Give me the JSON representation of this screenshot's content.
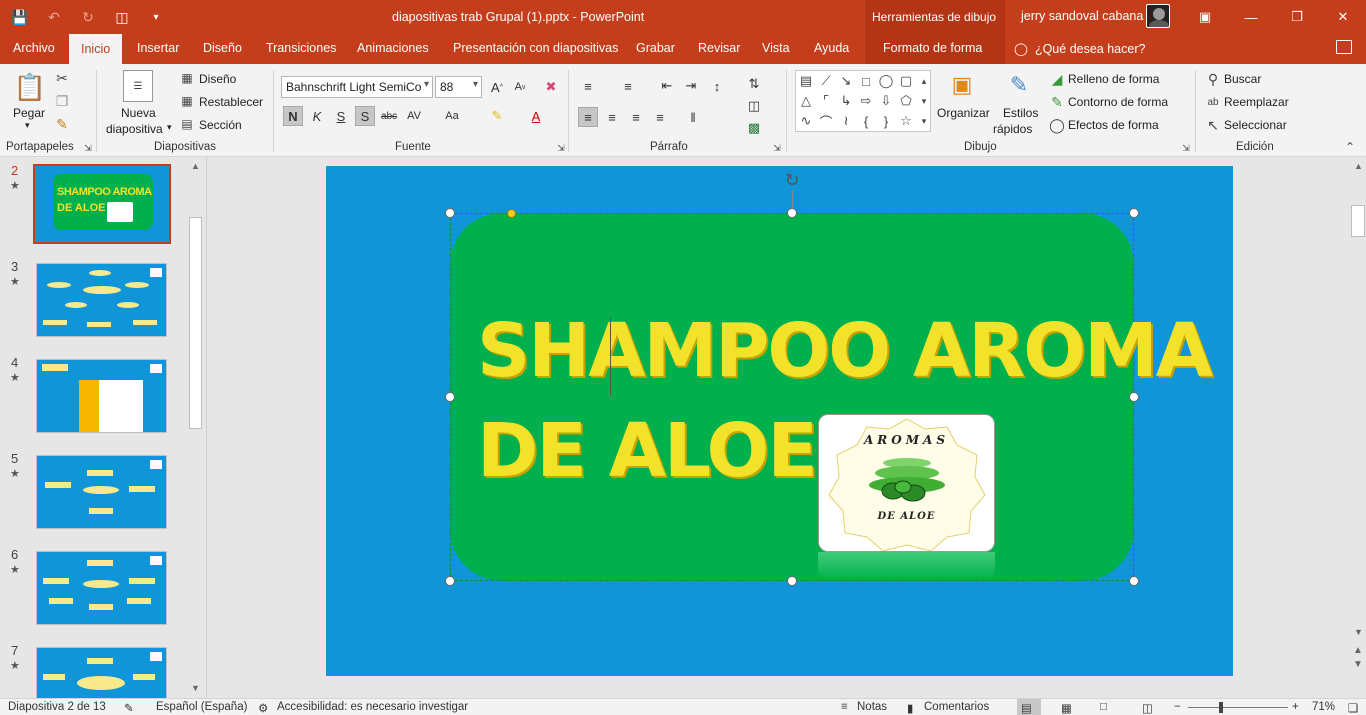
{
  "titlebar": {
    "doc_title": "diapositivas trab Grupal (1).pptx  -  PowerPoint",
    "context_tools": "Herramientas de dibujo",
    "user_name": "jerry sandoval cabana"
  },
  "tabs": {
    "items": [
      "Archivo",
      "Inicio",
      "Insertar",
      "Diseño",
      "Transiciones",
      "Animaciones",
      "Presentación con diapositivas",
      "Grabar",
      "Revisar",
      "Vista",
      "Ayuda",
      "Formato de forma"
    ],
    "active": "Inicio",
    "tell_me": "¿Qué desea hacer?"
  },
  "ribbon": {
    "portapapeles": {
      "label": "Portapapeles",
      "paste": "Pegar"
    },
    "diapositivas": {
      "label": "Diapositivas",
      "new_slide_1": "Nueva",
      "new_slide_2": "diapositiva",
      "layout": "Diseño",
      "reset": "Restablecer",
      "section": "Sección"
    },
    "fuente": {
      "label": "Fuente",
      "font_name": "Bahnschrift Light SemiCo",
      "font_size": "88",
      "bold": "N",
      "italic": "K",
      "underline": "S",
      "shadow": "S",
      "strike": "abc"
    },
    "parrafo": {
      "label": "Párrafo"
    },
    "dibujo": {
      "label": "Dibujo",
      "arrange": "Organizar",
      "quick_styles_1": "Estilos",
      "quick_styles_2": "rápidos",
      "fill": "Relleno de forma",
      "outline": "Contorno de forma",
      "effects": "Efectos de forma"
    },
    "edicion": {
      "label": "Edición",
      "find": "Buscar",
      "replace": "Reemplazar",
      "select": "Seleccionar"
    }
  },
  "thumbnails": [
    {
      "num": "2",
      "selected": true
    },
    {
      "num": "3",
      "selected": false
    },
    {
      "num": "4",
      "selected": false
    },
    {
      "num": "5",
      "selected": false
    },
    {
      "num": "6",
      "selected": false
    },
    {
      "num": "7",
      "selected": false
    }
  ],
  "slide": {
    "title_line1": "SHAMPOO AROMA",
    "title_line2": "DE ALOE",
    "thumb_title_1": "SHAMPOO AROMA",
    "thumb_title_2": "DE ALOE",
    "logo_top": "AROMAS",
    "logo_bottom": "DE ALOE",
    "bg_color": "#1096d8",
    "shape_color": "#00b04d",
    "title_color": "#f2e22a"
  },
  "status": {
    "slide_info": "Diapositiva 2 de 13",
    "language": "Español (España)",
    "accessibility": "Accesibilidad: es necesario investigar",
    "notes": "Notas",
    "comments": "Comentarios",
    "zoom": "71%"
  }
}
